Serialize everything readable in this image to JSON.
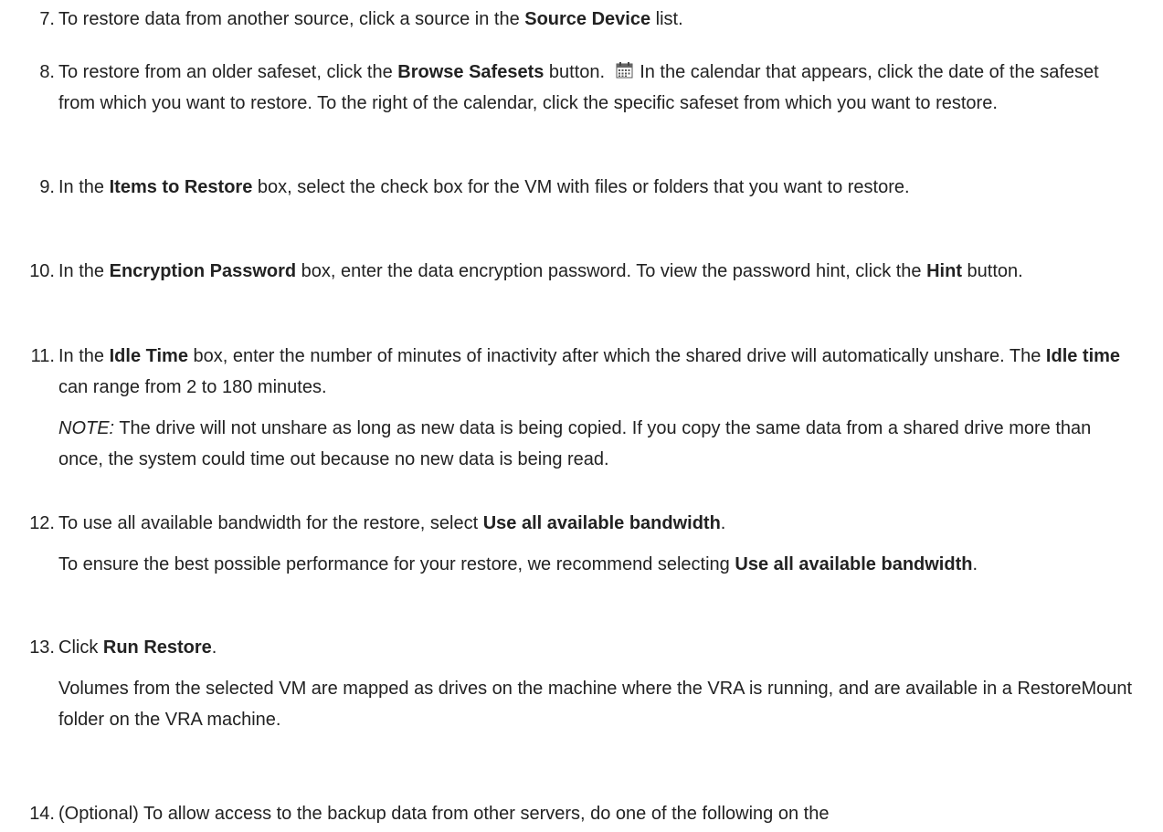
{
  "steps": [
    {
      "number": "7.",
      "parts": [
        {
          "t": "To restore data from another source, click a source in the "
        },
        {
          "t": "Source Device",
          "b": true
        },
        {
          "t": " list."
        }
      ]
    },
    {
      "number": "8.",
      "parts": [
        {
          "t": "To restore from an older safeset, click the "
        },
        {
          "t": "Browse Safesets",
          "b": true
        },
        {
          "t": " button. "
        },
        {
          "icon": "calendar-icon"
        },
        {
          "t": " In the calendar that appears, click the date of the safeset from which you want to restore. To the right of the calendar, click the specific safeset from which you want to restore."
        }
      ]
    },
    {
      "number": "9.",
      "parts": [
        {
          "t": "In the "
        },
        {
          "t": "Items to Restore",
          "b": true
        },
        {
          "t": " box, select the check box for the VM with files or folders that you want to restore."
        }
      ]
    },
    {
      "number": "10.",
      "parts": [
        {
          "t": "In the "
        },
        {
          "t": "Encryption Password",
          "b": true
        },
        {
          "t": " box, enter the data encryption password. To view the password hint, click the "
        },
        {
          "t": "Hint",
          "b": true
        },
        {
          "t": " button."
        }
      ]
    },
    {
      "number": "11.",
      "parts": [
        {
          "t": "In the "
        },
        {
          "t": "Idle Time",
          "b": true
        },
        {
          "t": " box, enter the number of minutes of inactivity after which the shared drive will automatically unshare. The "
        },
        {
          "t": "Idle time",
          "b": true
        },
        {
          "t": " can range from 2 to 180 minutes."
        }
      ],
      "extra": [
        [
          {
            "t": "NOTE:",
            "i": true
          },
          {
            "t": " The drive will not unshare as long as new data is being copied. If you copy the same data from a shared drive more than once, the system could time out because no new data is being read."
          }
        ]
      ]
    },
    {
      "number": "12.",
      "parts": [
        {
          "t": "To use all available bandwidth for the restore, select "
        },
        {
          "t": "Use all available bandwidth",
          "b": true
        },
        {
          "t": "."
        }
      ],
      "extra": [
        [
          {
            "t": "To ensure the best possible performance for your restore, we recommend selecting "
          },
          {
            "t": "Use all available bandwidth",
            "b": true
          },
          {
            "t": "."
          }
        ]
      ]
    },
    {
      "number": "13.",
      "parts": [
        {
          "t": "Click "
        },
        {
          "t": "Run Restore",
          "b": true
        },
        {
          "t": "."
        }
      ],
      "extra": [
        [
          {
            "t": "Volumes from the selected VM are mapped as drives on the machine where the VRA is running, and are available in a RestoreMount folder on the VRA machine."
          }
        ]
      ]
    },
    {
      "number": "14.",
      "parts": [
        {
          "t": "(Optional) To allow access to the backup data from other servers, do one of the following on the"
        }
      ]
    }
  ]
}
